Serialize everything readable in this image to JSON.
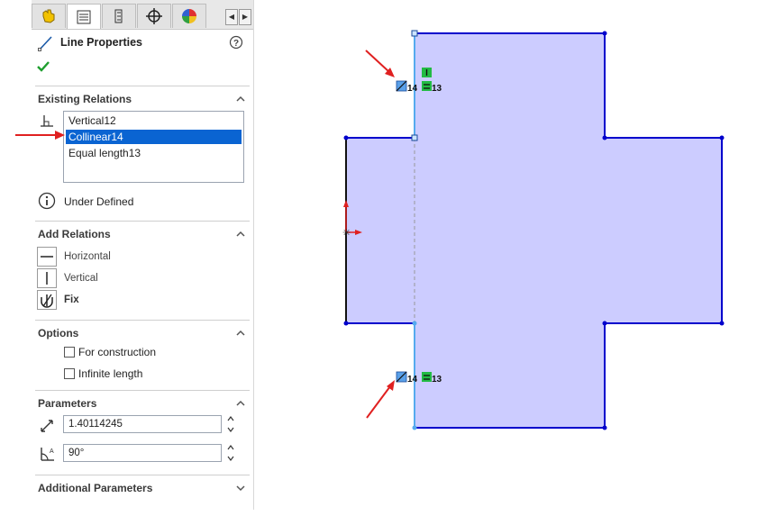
{
  "panel": {
    "tabs": [
      {
        "icon": "feature-manager-icon"
      },
      {
        "icon": "property-manager-icon"
      },
      {
        "icon": "configuration-manager-icon"
      },
      {
        "icon": "dimxpert-icon"
      },
      {
        "icon": "display-manager-icon"
      }
    ],
    "title": "Line Properties",
    "help_icon": "help-icon",
    "ok_icon": "ok-checkmark-icon",
    "existing_relations": {
      "header": "Existing Relations",
      "items": [
        "Vertical12",
        "Collinear14",
        "Equal length13"
      ],
      "selected_index": 1,
      "status": "Under Defined"
    },
    "add_relations": {
      "header": "Add Relations",
      "items": [
        "Horizontal",
        "Vertical",
        "Fix"
      ]
    },
    "options": {
      "header": "Options",
      "for_construction": "For construction",
      "infinite_length": "Infinite length",
      "for_construction_checked": false,
      "infinite_length_checked": false
    },
    "parameters": {
      "header": "Parameters",
      "length_value": "1.40114245",
      "angle_value": "90°"
    },
    "additional": {
      "header": "Additional Parameters"
    }
  },
  "sketch": {
    "relation_tags": [
      {
        "collinear": "14",
        "equal": "13"
      },
      {
        "collinear": "14",
        "equal": "13"
      }
    ],
    "colors": {
      "fill": "#ccccff",
      "outline": "#0000cc",
      "selected_line": "#55aaee",
      "annotation_arrow": "#e02020",
      "vertical_relation": "#22aa44"
    }
  }
}
